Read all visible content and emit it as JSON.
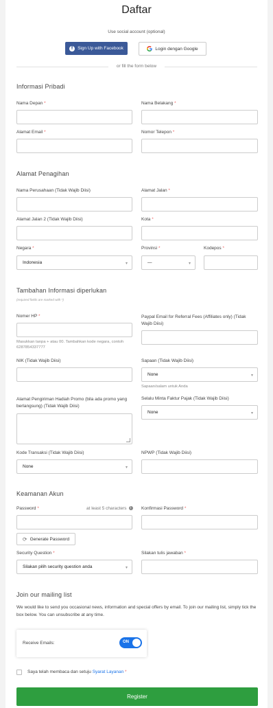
{
  "title": "Daftar",
  "social": {
    "caption": "Use social account (optional)",
    "facebook_label": "Sign Up with Facebook",
    "google_label": "Login dengan Google",
    "divider_label": "or fill the form below"
  },
  "sections": {
    "personal": "Informasi Pribadi",
    "billing": "Alamat Penagihan",
    "extra": "Tambahan Informasi diperlukan",
    "extra_note": "(required fields are marked with *)",
    "security": "Keamanan Akun",
    "mailing": "Join our mailing list"
  },
  "fields": {
    "first_name": "Nama Depan",
    "last_name": "Nama Belakang",
    "email": "Alamat Email",
    "phone": "Nomor Telepon",
    "company": "Nama Perusahaan (Tidak Wajib Diisi)",
    "address1": "Alamat Jalan",
    "address2": "Alamat Jalan 2 (Tidak Wajib Diisi)",
    "city": "Kota",
    "country": "Negara",
    "country_value": "Indonesia",
    "province": "Provinsi",
    "province_value": "—",
    "postcode": "Kodepos",
    "hp": "Nomer HP",
    "hp_hint": "Masukkan tanpa + atau 00. Tambahkan kode negara, contoh 6287854337777",
    "paypal": "Paypal Email for Referral Fees (Affiliates only) (Tidak Wajib Diisi)",
    "nik": "NIK (Tidak Wajib Diisi)",
    "greeting": "Sapaan (Tidak Wajib Diisi)",
    "greeting_value": "None",
    "greeting_hint": "Sapaan/salam untuk Anda",
    "promo_address": "Alamat Pengiriman Hadiah Promo (bila ada promo yang berlangsung) (Tidak Wajib Diisi)",
    "tax_invoice": "Selalu Minta Faktur Pajak (Tidak Wajib Diisi)",
    "tax_invoice_value": "None",
    "transaction_code": "Kode Transaksi (Tidak Wajib Diisi)",
    "transaction_code_value": "None",
    "npwp": "NPWP (Tidak Wajib Diisi)",
    "password": "Password",
    "password_hint": "at least 5 characters",
    "confirm_password": "Konfirmasi Password",
    "generate_password": "Generate Password",
    "security_question": "Security Question",
    "security_question_value": "Silakan pilih security question anda",
    "security_answer": "Silakan tulis jawaban"
  },
  "mailing": {
    "description": "We would like to send you occasional news, information and special offers by email. To join our mailing list, simply tick the box below. You can unsubscribe at any time.",
    "receive_label": "Receive Emails:",
    "toggle_label": "ON"
  },
  "agreement": {
    "text": "Saya telah membaca dan setuju",
    "link": "Syarat Layanan"
  },
  "register_label": "Register",
  "colors": {
    "facebook": "#3b5998",
    "register": "#2e9e3f",
    "toggle": "#1a73e8",
    "required": "#e66666"
  }
}
